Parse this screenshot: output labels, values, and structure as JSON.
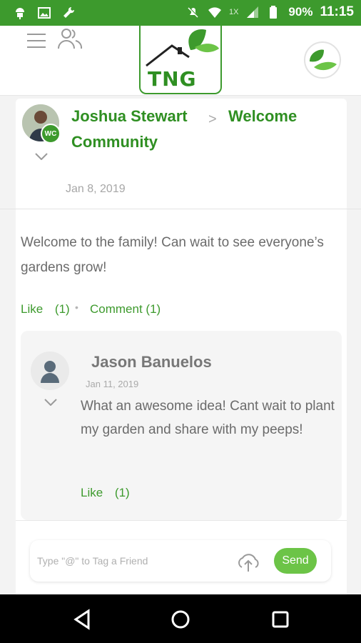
{
  "status_bar": {
    "battery": "90%",
    "time": "11:15",
    "network_badge": "1X"
  },
  "header": {
    "logo_text": "TNG"
  },
  "post": {
    "author": "Joshua Stewart",
    "separator": ">",
    "community_line1": "Welcome",
    "community_line2": "Community",
    "badge": "WC",
    "date": "Jan 8, 2019",
    "body": "Welcome to the family! Can wait to see everyone’s gardens grow!",
    "like_label": "Like",
    "like_count": "(1)",
    "separator_dot": "•",
    "comment_label": "Comment",
    "comment_count": "(1)"
  },
  "comment": {
    "author": "Jason Banuelos",
    "date": "Jan 11, 2019",
    "body": "What an awesome idea! Cant wait to plant my garden and share with my peeps!",
    "like_label": "Like",
    "like_count": "(1)"
  },
  "composer": {
    "placeholder": "Type \"@\" to Tag a Friend",
    "send_label": "Send"
  },
  "colors": {
    "brand_green": "#3d9a2d",
    "send_green": "#6cc447"
  }
}
